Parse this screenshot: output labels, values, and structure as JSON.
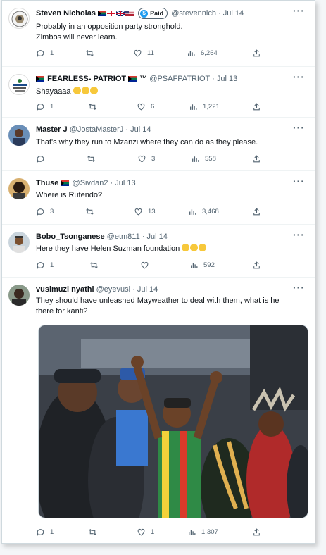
{
  "tweets": [
    {
      "name": "Steven Nicholas",
      "paid_label": "Paid",
      "handle": "@stevennich",
      "sep": "·",
      "date": "Jul 14",
      "lines": [
        "Probably in an opposition party stronghold.",
        "Zimbos will never learn."
      ],
      "replies": "1",
      "retweets": "",
      "likes": "11",
      "views": "6,264"
    },
    {
      "name": "FEARLESS- PATRIOT",
      "suffix": "™",
      "handle": "@PSAFPATRIOT",
      "sep": "·",
      "date": "Jul 13",
      "lines": [
        "Shayaaaa"
      ],
      "replies": "1",
      "retweets": "",
      "likes": "6",
      "views": "1,221"
    },
    {
      "name": "Master J",
      "handle": "@JostaMasterJ",
      "sep": "·",
      "date": "Jul 14",
      "lines": [
        "That's why they run to Mzanzi where they can do as they please."
      ],
      "replies": "",
      "retweets": "",
      "likes": "3",
      "views": "558"
    },
    {
      "name": "Thuse",
      "handle": "@Sivdan2",
      "sep": "·",
      "date": "Jul 13",
      "lines": [
        "Where is Rutendo?"
      ],
      "replies": "3",
      "retweets": "",
      "likes": "13",
      "views": "3,468"
    },
    {
      "name": "Bobo_Tsonganese",
      "handle": "@etm811",
      "sep": "·",
      "date": "Jul 14",
      "lines": [
        "Here they have Helen Suzman foundation"
      ],
      "replies": "1",
      "retweets": "",
      "likes": "",
      "views": "592"
    },
    {
      "name": "vusimuzi nyathi",
      "handle": "@eyevusi",
      "sep": "·",
      "date": "Jul 14",
      "lines": [
        "They should have unleashed Mayweather to deal with them, what is he",
        "there for kanti?"
      ],
      "replies": "1",
      "retweets": "",
      "likes": "1",
      "views": "1,307"
    }
  ],
  "more_glyph": "···",
  "colors": {
    "text": "#0f1419",
    "muted": "#536471",
    "accent": "#1d9bf0",
    "border": "#eff3f4"
  },
  "icons": [
    "reply-icon",
    "retweet-icon",
    "like-icon",
    "views-icon",
    "share-icon",
    "more-icon",
    "verified-paid-icon"
  ]
}
